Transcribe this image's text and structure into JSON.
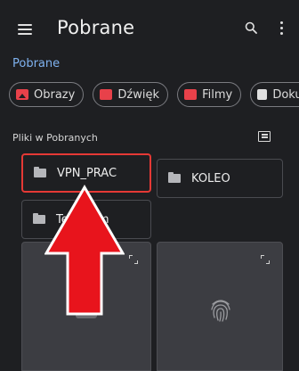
{
  "appbar": {
    "title": "Pobrane"
  },
  "breadcrumb": "Pobrane",
  "chips": [
    {
      "label": "Obrazy",
      "icon": "image-icon"
    },
    {
      "label": "Dźwięk",
      "icon": "audio-icon"
    },
    {
      "label": "Filmy",
      "icon": "video-icon"
    },
    {
      "label": "Dokumenty",
      "icon": "document-icon"
    }
  ],
  "section": {
    "label": "Pliki w Pobranych"
  },
  "folders": [
    {
      "name": "VPN_PRAC"
    },
    {
      "name": "KOLEO"
    },
    {
      "name": "Telegram"
    }
  ],
  "colors": {
    "background": "#1e1f22",
    "accent": "#7fb2f0",
    "chip_icon": "#e8414a",
    "highlight": "#e53935"
  }
}
